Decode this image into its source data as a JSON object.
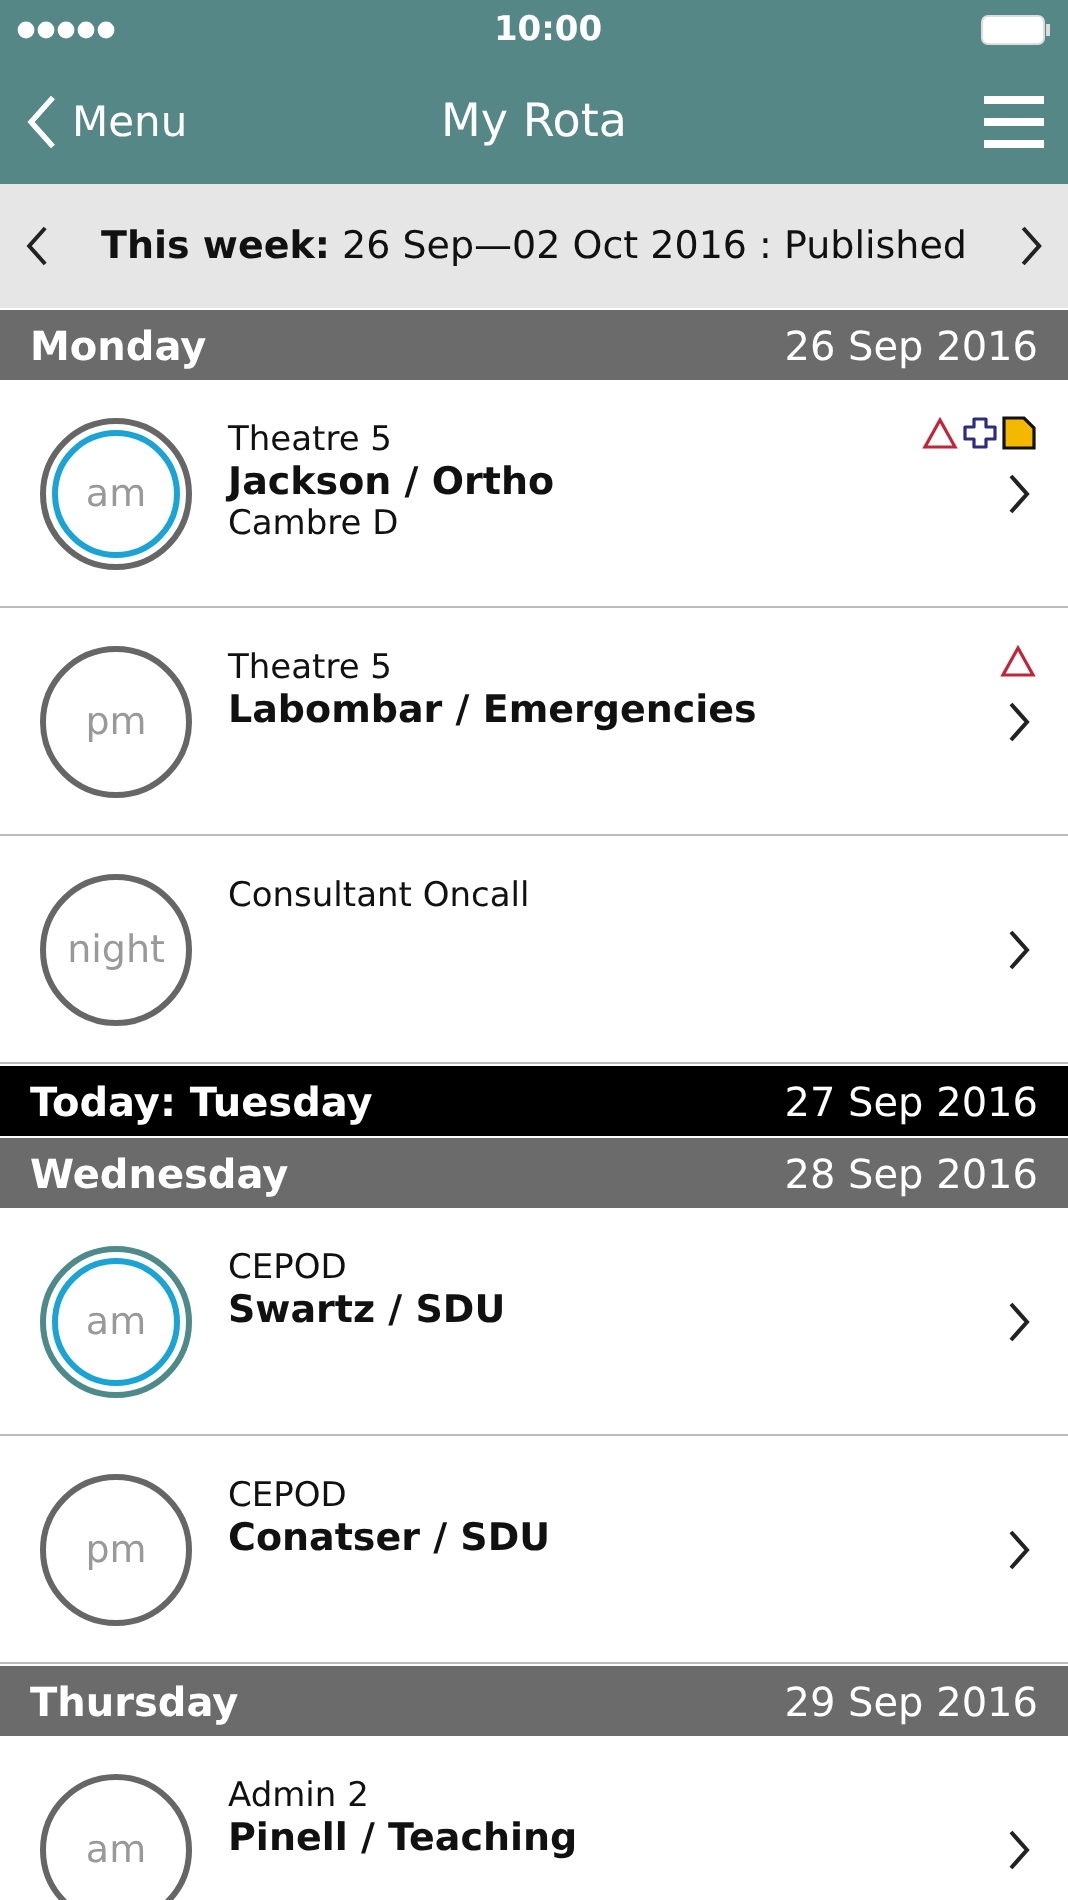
{
  "status_bar": {
    "time": "10:00"
  },
  "nav": {
    "back": "Menu",
    "title": "My Rota"
  },
  "week": {
    "label": "This week:",
    "range": "26 Sep—02 Oct 2016 : Published"
  },
  "days": [
    {
      "kind": "normal",
      "name": "Monday",
      "date": "26 Sep 2016",
      "shifts": [
        {
          "period": "am",
          "color": "#666666",
          "active": true,
          "location": "Theatre 5",
          "title": "Jackson / Ortho",
          "person": "Cambre D",
          "flags": [
            {
              "kind": "warning"
            },
            {
              "kind": "cross"
            },
            {
              "kind": "note"
            }
          ]
        },
        {
          "period": "pm",
          "color": "#666666",
          "active": false,
          "location": "Theatre 5",
          "title": "Labombar / Emergencies",
          "flags": [
            {
              "kind": "warning"
            }
          ]
        },
        {
          "period": "night",
          "color": "#666666",
          "active": false,
          "location": "Consultant Oncall"
        }
      ]
    },
    {
      "kind": "today",
      "name": "Today: Tuesday",
      "date": "27 Sep 2016"
    },
    {
      "kind": "normal",
      "name": "Wednesday",
      "date": "28 Sep 2016",
      "shifts": [
        {
          "period": "am",
          "color": "#4f8a8b",
          "active": true,
          "location": "CEPOD",
          "title": "Swartz / SDU"
        },
        {
          "period": "pm",
          "color": "#666666",
          "active": false,
          "location": "CEPOD",
          "title": "Conatser / SDU"
        }
      ]
    },
    {
      "kind": "normal",
      "name": "Thursday",
      "date": "29 Sep 2016",
      "shifts": [
        {
          "period": "am",
          "color": "#666666",
          "active": false,
          "location": "Admin 2",
          "title": "Pinell / Teaching"
        }
      ]
    }
  ]
}
